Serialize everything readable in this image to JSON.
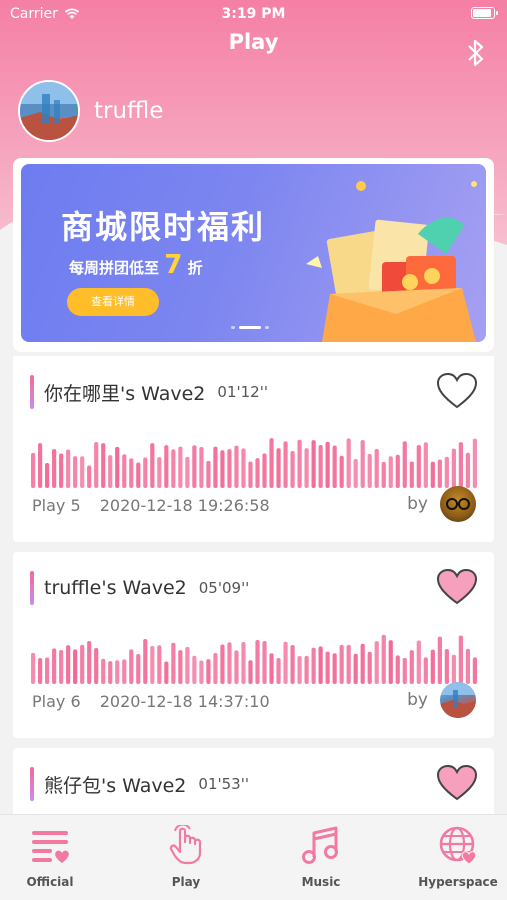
{
  "status": {
    "carrier": "Carrier",
    "time": "3:19 PM"
  },
  "nav": {
    "title": "Play"
  },
  "profile": {
    "name": "truffle"
  },
  "banner": {
    "title": "商城限时福利",
    "subtitle_prefix": "每周拼团低至",
    "subtitle_number": "7",
    "subtitle_suffix": "折",
    "button": "查看详情"
  },
  "cards": [
    {
      "title": "你在哪里's Wave2",
      "duration": "01'12''",
      "plays": "Play  5",
      "date": "2020-12-18 19:26:58",
      "by": "by",
      "liked": false
    },
    {
      "title": "truffle's Wave2",
      "duration": "05'09''",
      "plays": "Play  6",
      "date": "2020-12-18 14:37:10",
      "by": "by",
      "liked": true
    },
    {
      "title": "熊仔包's Wave2",
      "duration": "01'53''",
      "liked": true
    }
  ],
  "tabs": [
    {
      "label": "Official",
      "icon": "list-heart-icon"
    },
    {
      "label": "Play",
      "icon": "hand-tap-icon"
    },
    {
      "label": "Music",
      "icon": "music-note-icon"
    },
    {
      "label": "Hyperspace",
      "icon": "globe-heart-icon"
    }
  ],
  "colors": {
    "accent": "#f56a9a",
    "heart_fill": "#f6a0bd",
    "wave": "#f26a96"
  }
}
